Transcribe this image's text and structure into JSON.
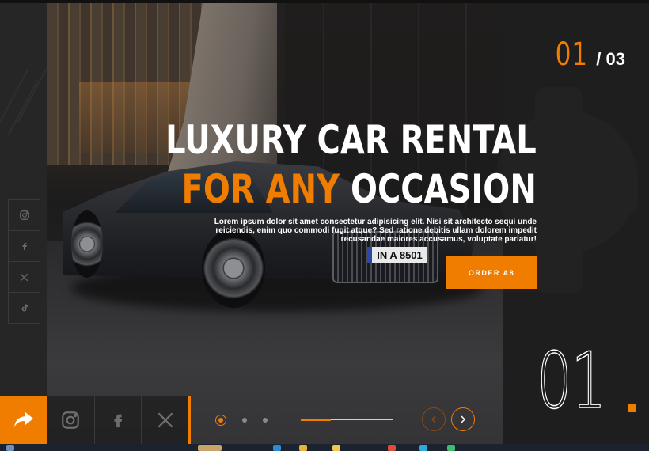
{
  "slider": {
    "current_index": "01",
    "total": "/ 03",
    "big_index": "01",
    "active_slide": 1,
    "slide_count": 3,
    "progress_fraction": 0.33
  },
  "hero": {
    "headline_line1": "LUXURY CAR RENTAL",
    "headline_line2_accent": "FOR ANY",
    "headline_line2_rest": " OCCASION",
    "description": "Lorem ipsum dolor sit amet consectetur adipisicing elit. Nisi sit architecto sequi unde reiciendis, enim quo commodi fugit atque? Sed ratione debitis ullam dolorem impedit recusandae maiores accusamus, voluptate pariatur!",
    "cta_label": "ORDER A8",
    "plate_text": "IN A 8501"
  },
  "social_sidebar": [
    {
      "name": "instagram-icon"
    },
    {
      "name": "facebook-icon"
    },
    {
      "name": "x-twitter-icon"
    },
    {
      "name": "tiktok-icon"
    }
  ],
  "bottom_social": [
    {
      "name": "instagram-icon"
    },
    {
      "name": "facebook-icon"
    },
    {
      "name": "x-twitter-icon"
    }
  ],
  "colors": {
    "accent": "#f07d00",
    "background": "#1e1e1e",
    "text": "#ffffff"
  }
}
